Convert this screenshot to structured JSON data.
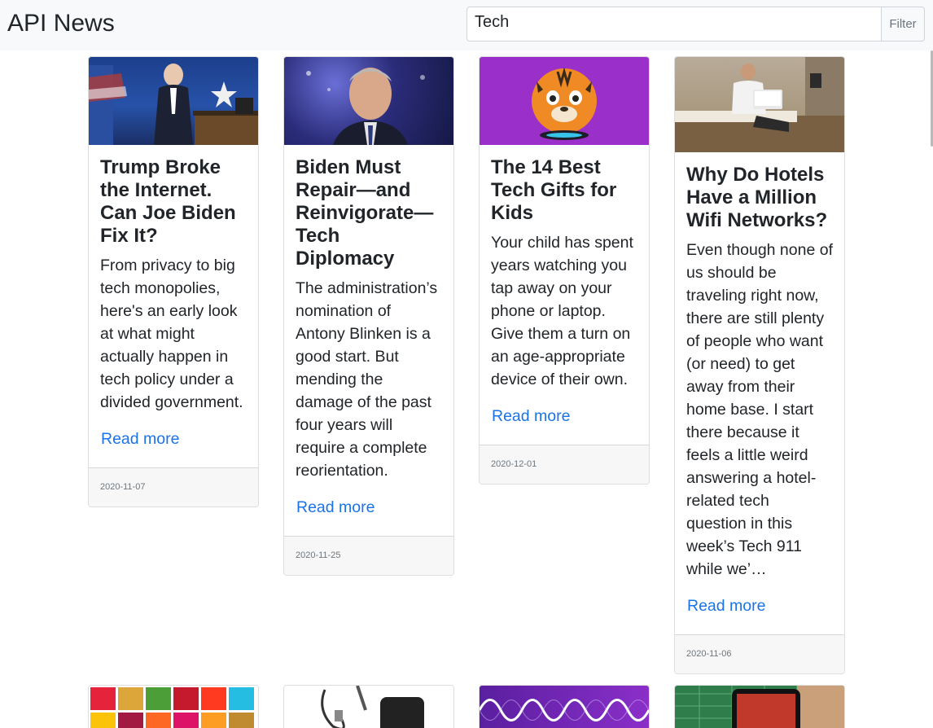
{
  "app": {
    "title": "API News"
  },
  "search": {
    "value": "Tech",
    "button_label": "Filter"
  },
  "articles": [
    {
      "title": "Trump Broke the Internet. Can Joe Biden Fix It?",
      "description": "From privacy to big tech monopolies, here's an early look at what might actually happen in tech policy under a divided government.",
      "link_label": "Read more",
      "date": "2020-11-07",
      "image_icon": "biden-podium-photo"
    },
    {
      "title": "Biden Must Repair—and Reinvigorate—Tech Diplomacy",
      "description": "The administration’s nomination of Antony Blinken is a good start. But mending the damage of the past four years will require a complete reorientation.",
      "link_label": "Read more",
      "date": "2020-11-25",
      "image_icon": "blinken-portrait-photo"
    },
    {
      "title": "The 14 Best Tech Gifts for Kids",
      "description": "Your child has spent years watching you tap away on your phone or laptop. Give them a turn on an age-appropriate device of their own.",
      "link_label": "Read more",
      "date": "2020-12-01",
      "image_icon": "tiger-smart-speaker-photo"
    },
    {
      "title": "Why Do Hotels Have a Million Wifi Networks?",
      "description": "Even though none of us should be traveling right now, there are still plenty of people who want (or need) to get away from their home base. I start there because it feels a little weird answering a hotel-related tech question in this week’s Tech 911 while we’…",
      "link_label": "Read more",
      "date": "2020-11-06",
      "image_icon": "man-laptop-hotel-bed-photo"
    },
    {
      "image_icon": "sdg-goals-grid-image"
    },
    {
      "image_icon": "cables-gadget-photo"
    },
    {
      "image_icon": "sine-wave-illustration"
    },
    {
      "image_icon": "smartphone-desk-photo"
    }
  ],
  "colors": {
    "link": "#1a73e8",
    "navbar": "#f8f9fa",
    "footer": "#f7f7f7",
    "text": "#212529",
    "muted": "#6c757d"
  }
}
